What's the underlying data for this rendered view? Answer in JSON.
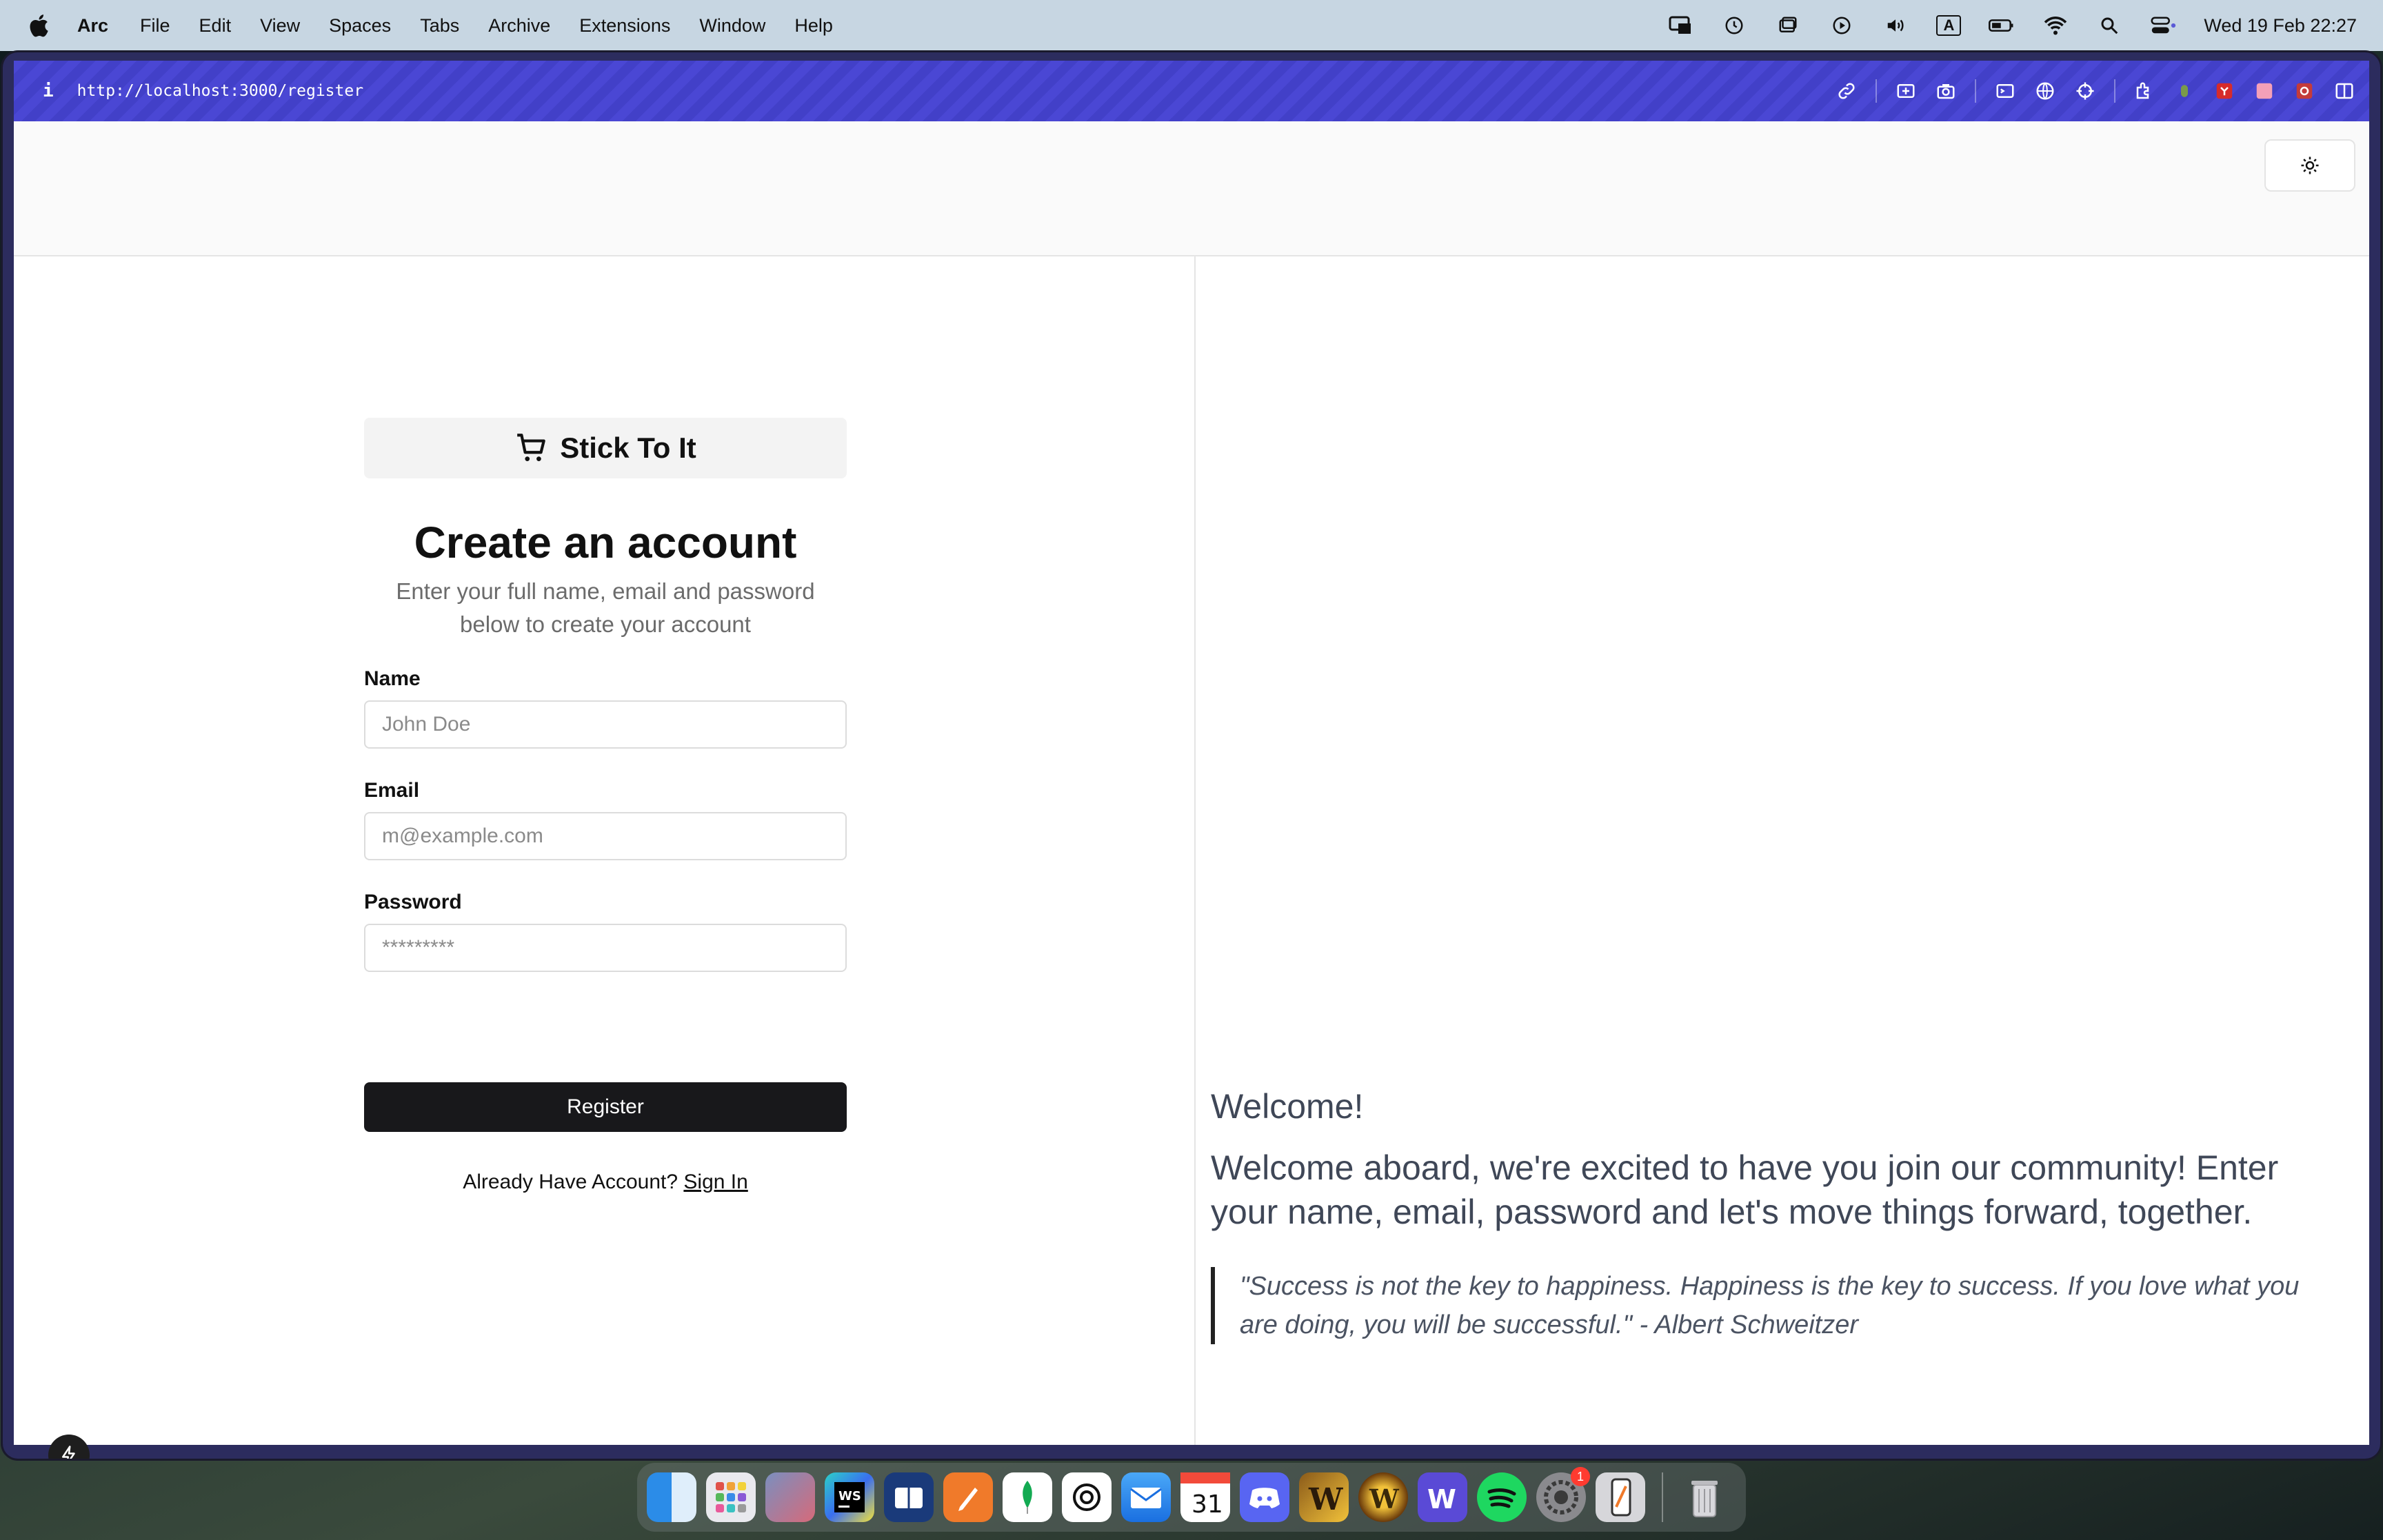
{
  "menubar": {
    "app_name": "Arc",
    "items": [
      "File",
      "Edit",
      "View",
      "Spaces",
      "Tabs",
      "Archive",
      "Extensions",
      "Window",
      "Help"
    ],
    "datetime": "Wed 19 Feb  22:27",
    "input_source": "A"
  },
  "browser": {
    "info_label": "i",
    "url": "http://localhost:3000/register"
  },
  "brand": {
    "name": "Stick To It"
  },
  "form": {
    "title": "Create an account",
    "subtitle": "Enter your full name, email and password below to create your account",
    "name_label": "Name",
    "name_placeholder": "John Doe",
    "email_label": "Email",
    "email_placeholder": "m@example.com",
    "password_label": "Password",
    "password_placeholder": "*********",
    "register_label": "Register",
    "signin_prompt": "Already Have Account?",
    "signin_link": "Sign In"
  },
  "welcome": {
    "title": "Welcome!",
    "text": "Welcome aboard, we're excited to have you join our community! Enter your name, email, password and let's move things forward, together.",
    "quote": "\"Success is not the key to happiness. Happiness is the key to success. If you love what you are doing, you will be successful.\" - Albert Schweitzer"
  },
  "dock": {
    "apps": [
      "Finder",
      "Launchpad",
      "Affinity",
      "WebStorm",
      "Notes",
      "Pages",
      "MongoDB",
      "ChatGPT",
      "Mail",
      "Calendar",
      "Discord",
      "Warcraft",
      "World of Warcraft",
      "Word",
      "Spotify",
      "System Settings",
      "Simulator",
      "Trash"
    ],
    "calendar_day": "31",
    "settings_badge": "1",
    "colors": {
      "accent": "#4a47d4",
      "button": "#18181b"
    }
  }
}
